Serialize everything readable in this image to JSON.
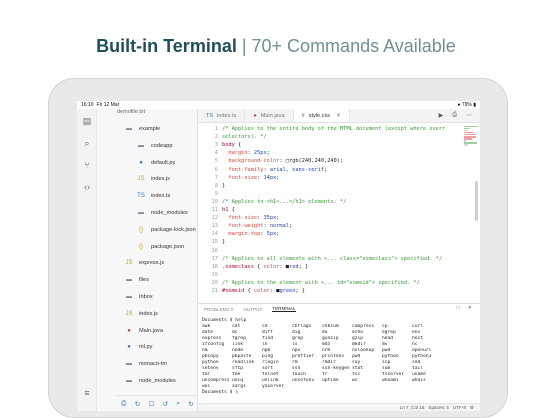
{
  "headline": {
    "strong": "Built-in Terminal",
    "light": "| 70+ Commands Available"
  },
  "status": {
    "time": "16:10",
    "date": "Fri 12 Mar",
    "right": "● 79% ▮"
  },
  "explorer": {
    "title": "demofile.txt",
    "items": [
      {
        "label": "example",
        "icon": "folder-icon",
        "chev": "∨",
        "indent": 0
      },
      {
        "label": "codeapp",
        "icon": "folder-icon",
        "chev": "›",
        "indent": 1
      },
      {
        "label": "default.py",
        "icon": "python-file-icon",
        "chev": "",
        "indent": 1
      },
      {
        "label": "index.js",
        "icon": "js-file-icon",
        "chev": "",
        "indent": 1
      },
      {
        "label": "index.ts",
        "icon": "ts-file-icon",
        "chev": "",
        "indent": 1
      },
      {
        "label": "node_modules",
        "icon": "folder-icon",
        "chev": "›",
        "indent": 1
      },
      {
        "label": "package-lock.json",
        "icon": "json-file-icon",
        "chev": "",
        "indent": 1
      },
      {
        "label": "package.json",
        "icon": "json-file-icon",
        "chev": "",
        "indent": 1
      },
      {
        "label": "express.js",
        "icon": "js-file-icon",
        "chev": "",
        "indent": 0
      },
      {
        "label": "files",
        "icon": "folder-icon",
        "chev": "›",
        "indent": 0
      },
      {
        "label": "Inbox",
        "icon": "folder-icon",
        "chev": "›",
        "indent": 0
      },
      {
        "label": "index.js",
        "icon": "js-file-icon",
        "chev": "",
        "indent": 0
      },
      {
        "label": "Main.java",
        "icon": "java-file-icon",
        "chev": "",
        "indent": 0
      },
      {
        "label": "ml.py",
        "icon": "python-file-icon",
        "chev": "",
        "indent": 0
      },
      {
        "label": "monaco-tm",
        "icon": "folder-icon",
        "chev": "›",
        "indent": 0
      },
      {
        "label": "node_modules",
        "icon": "folder-icon",
        "chev": "›",
        "indent": 0
      }
    ]
  },
  "tabs": [
    {
      "label": "index.ts",
      "icon": "ts-file-icon",
      "active": false
    },
    {
      "label": "Main.java",
      "icon": "java-file-icon",
      "active": false
    },
    {
      "label": "style.css",
      "icon": "css-file-icon",
      "active": true
    }
  ],
  "editor": {
    "lines": [
      {
        "n": "1",
        "parts": [
          [
            "c-com",
            "/* Applies to the entire body of the HTML document (except where overr"
          ]
        ]
      },
      {
        "n": "2",
        "parts": [
          [
            "c-com",
            "selectors). */"
          ]
        ]
      },
      {
        "n": "3",
        "parts": [
          [
            "c-sel",
            "body"
          ],
          [
            "c-plain",
            " {"
          ]
        ]
      },
      {
        "n": "4",
        "parts": [
          [
            "c-prop",
            "  margin"
          ],
          [
            "c-plain",
            ": "
          ],
          [
            "c-val",
            "25px"
          ],
          [
            "c-plain",
            ";"
          ]
        ]
      },
      {
        "n": "5",
        "parts": [
          [
            "c-prop",
            "  background-color"
          ],
          [
            "c-plain",
            ": □rgb(240,240,240);"
          ]
        ]
      },
      {
        "n": "6",
        "parts": [
          [
            "c-prop",
            "  font-family"
          ],
          [
            "c-plain",
            ": "
          ],
          [
            "c-val",
            "arial, sans-serif"
          ],
          [
            "c-plain",
            ";"
          ]
        ]
      },
      {
        "n": "7",
        "parts": [
          [
            "c-prop",
            "  font-size"
          ],
          [
            "c-plain",
            ": "
          ],
          [
            "c-val",
            "14px"
          ],
          [
            "c-plain",
            ";"
          ]
        ]
      },
      {
        "n": "8",
        "parts": [
          [
            "c-plain",
            "}"
          ]
        ]
      },
      {
        "n": "9",
        "parts": [
          [
            "c-plain",
            ""
          ]
        ]
      },
      {
        "n": "10",
        "parts": [
          [
            "c-com",
            "/* Applies to <h1>...</h1> elements. */"
          ]
        ]
      },
      {
        "n": "11",
        "parts": [
          [
            "c-sel",
            "h1"
          ],
          [
            "c-plain",
            " {"
          ]
        ]
      },
      {
        "n": "12",
        "parts": [
          [
            "c-prop",
            "  font-size"
          ],
          [
            "c-plain",
            ": "
          ],
          [
            "c-val",
            "35px"
          ],
          [
            "c-plain",
            ";"
          ]
        ]
      },
      {
        "n": "13",
        "parts": [
          [
            "c-prop",
            "  font-weight"
          ],
          [
            "c-plain",
            ": "
          ],
          [
            "c-val",
            "normal"
          ],
          [
            "c-plain",
            ";"
          ]
        ]
      },
      {
        "n": "14",
        "parts": [
          [
            "c-prop",
            "  margin-top"
          ],
          [
            "c-plain",
            ": "
          ],
          [
            "c-val",
            "5px"
          ],
          [
            "c-plain",
            ";"
          ]
        ]
      },
      {
        "n": "15",
        "parts": [
          [
            "c-plain",
            "}"
          ]
        ]
      },
      {
        "n": "16",
        "parts": [
          [
            "c-plain",
            ""
          ]
        ]
      },
      {
        "n": "17",
        "parts": [
          [
            "c-com",
            "/* Applies to all elements with <... class=\"someclass\"> specified. */"
          ]
        ]
      },
      {
        "n": "18",
        "parts": [
          [
            "c-sel",
            ".someclass"
          ],
          [
            "c-plain",
            " { "
          ],
          [
            "c-prop",
            "color"
          ],
          [
            "c-plain",
            ": ■"
          ],
          [
            "c-val",
            "red"
          ],
          [
            "c-plain",
            "; }"
          ]
        ]
      },
      {
        "n": "19",
        "parts": [
          [
            "c-plain",
            ""
          ]
        ]
      },
      {
        "n": "20",
        "parts": [
          [
            "c-com",
            "/* Applies to the element with <... id=\"someid\"> specified. */"
          ]
        ]
      },
      {
        "n": "21",
        "parts": [
          [
            "c-sel",
            "#someid"
          ],
          [
            "c-plain",
            " { "
          ],
          [
            "c-prop",
            "color"
          ],
          [
            "c-plain",
            ": ■"
          ],
          [
            "c-val",
            "green"
          ],
          [
            "c-plain",
            "; }"
          ]
        ]
      }
    ]
  },
  "panel": {
    "tabs": [
      "PROBLEMS",
      "OUTPUT",
      "TERMINAL"
    ],
    "problems_count": "0",
    "active_tab": "TERMINAL",
    "header": "Documents $ help",
    "commands": [
      [
        "awk",
        "cat",
        "cd",
        "chflags",
        "chksum",
        "compress",
        "cp",
        "curl"
      ],
      [
        "date",
        "dc",
        "diff",
        "dig",
        "du",
        "echo",
        "egrep",
        "env"
      ],
      [
        "express",
        "fgrep",
        "find",
        "grep",
        "gunzip",
        "gzip",
        "head",
        "host"
      ],
      [
        "ifconfig",
        "link",
        "ln",
        "ls",
        "md5",
        "mkdir",
        "mv",
        "nc"
      ],
      [
        "nm",
        "node",
        "npm",
        "npx",
        "nrm",
        "nslookup",
        "pwd",
        "openurl"
      ],
      [
        "pbcopy",
        "pbpaste",
        "ping",
        "prettier",
        "printenv",
        "pwd",
        "python",
        "python3"
      ],
      [
        "python",
        "readlink",
        "rlogin",
        "rm",
        "rmdir",
        "say",
        "scp",
        "sed"
      ],
      [
        "setenv",
        "sftp",
        "sort",
        "ssh",
        "ssh-keygen",
        "stat",
        "sum",
        "tail"
      ],
      [
        "tar",
        "tee",
        "telnet",
        "touch",
        "tr",
        "tsc",
        "tsserver",
        "uname"
      ],
      [
        "uncompress",
        "uniq",
        "unlink",
        "unsetenv",
        "uptime",
        "wc",
        "whoami",
        "whois"
      ],
      [
        "wol",
        "xargs",
        "yaserver",
        "",
        "",
        "",
        "",
        ""
      ]
    ],
    "prompt": "Documents $ ▯",
    "icons": [
      "□",
      "✕"
    ]
  },
  "statusline": {
    "position": "Ln 7, Col 16",
    "spaces": "Spaces: 4",
    "encoding": "UTF-8",
    "gear": "⚙"
  },
  "toolbar_icons": [
    "⎙",
    "↻",
    "☐",
    "↺",
    "⌕",
    "↻"
  ],
  "activity_icons": [
    "▤",
    "⌕",
    "⑂",
    "‹›",
    "≡",
    "⚙"
  ],
  "tab_actions": [
    "▶",
    "⎙",
    "⋯"
  ]
}
